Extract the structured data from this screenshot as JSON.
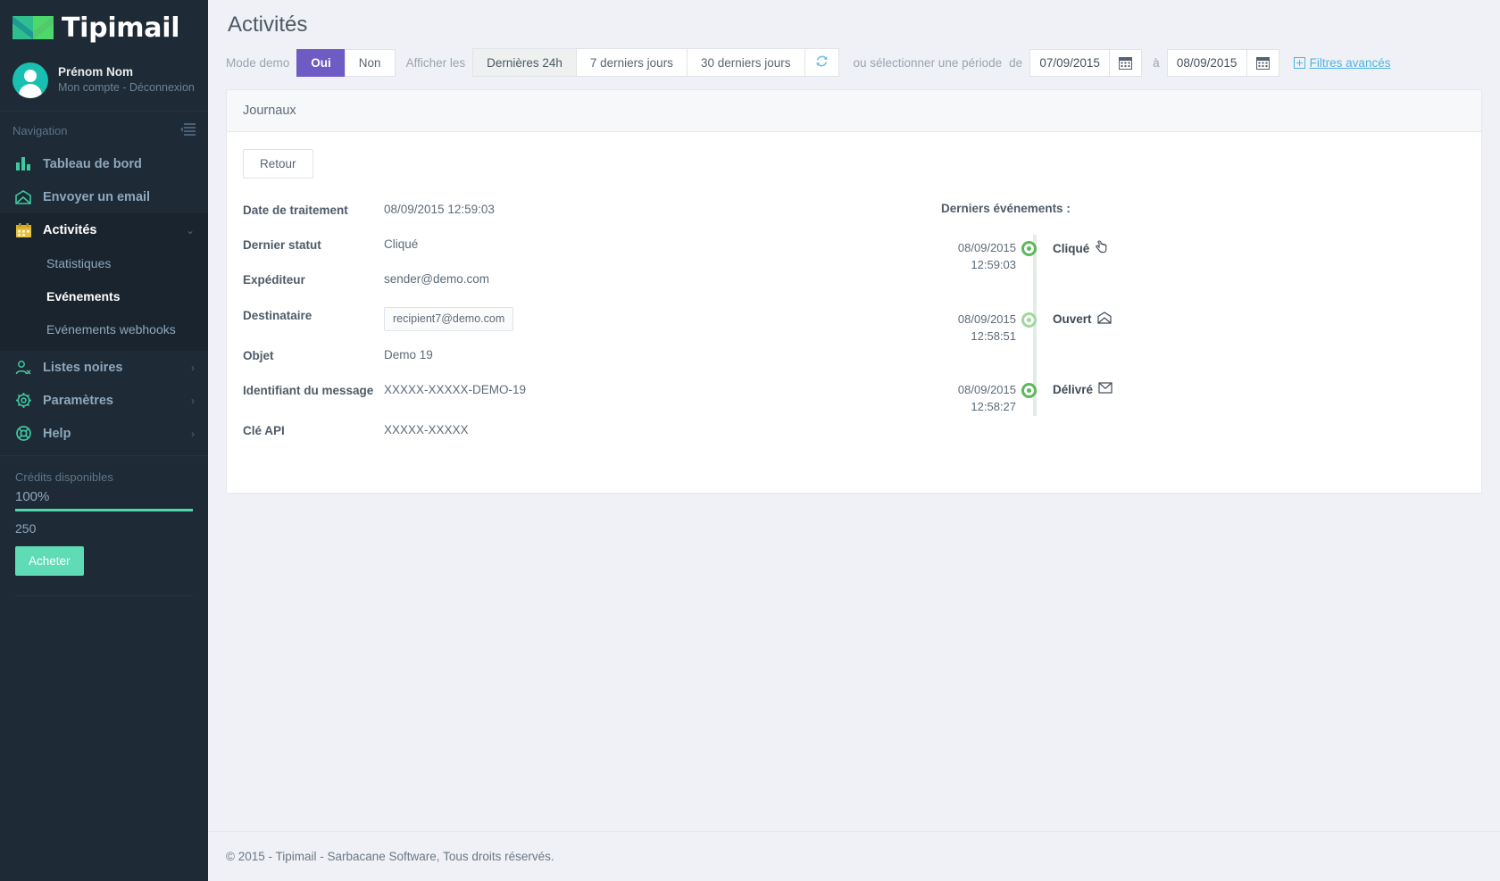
{
  "brand": {
    "name": "Tipimail"
  },
  "user": {
    "name": "Prénom Nom",
    "links": "Mon compte - Déconnexion"
  },
  "sidebar": {
    "nav_title": "Navigation",
    "collapse_icon": "collapse-menu-icon",
    "items": [
      {
        "label": "Tableau de bord",
        "icon": "bar-chart-icon",
        "chevron": ""
      },
      {
        "label": "Envoyer un email",
        "icon": "envelope-open-icon",
        "chevron": ""
      },
      {
        "label": "Activités",
        "icon": "calendar-icon",
        "chevron": "⌄",
        "active": true
      },
      {
        "label": "Listes noires",
        "icon": "user-block-icon",
        "chevron": "›"
      },
      {
        "label": "Paramètres",
        "icon": "gear-icon",
        "chevron": "›"
      },
      {
        "label": "Help",
        "icon": "lifebuoy-icon",
        "chevron": "›"
      }
    ],
    "subitems": [
      {
        "label": "Statistiques",
        "active": false
      },
      {
        "label": "Evénements",
        "active": true
      },
      {
        "label": "Evénements webhooks",
        "active": false
      }
    ],
    "credits": {
      "label": "Crédits disponibles",
      "percent": "100%",
      "count": "250",
      "buy_label": "Acheter",
      "bar_color": "#4fd8ab"
    }
  },
  "header": {
    "title": "Activités"
  },
  "toolbar": {
    "demo_mode_label": "Mode demo",
    "demo_yes": "Oui",
    "demo_no": "Non",
    "show_label": "Afficher les",
    "ranges": [
      "Dernières 24h",
      "7 derniers jours",
      "30 derniers jours"
    ],
    "active_range": "Dernières 24h",
    "refresh_icon": "refresh-icon",
    "or_period_label": "ou sélectionner une période",
    "from_label": "de",
    "to_label": "à",
    "date_from": "07/09/2015",
    "date_to": "08/09/2015",
    "calendar_icon": "calendar-icon",
    "advanced_filters": "Filtres avancés",
    "accent_purple": "#6e5cc4",
    "link_blue": "#52b3e4"
  },
  "panel": {
    "title": "Journaux",
    "back_label": "Retour",
    "details": [
      {
        "label": "Date de traitement",
        "value": "08/09/2015 12:59:03",
        "chip": false
      },
      {
        "label": "Dernier statut",
        "value": "Cliqué",
        "chip": false
      },
      {
        "label": "Expéditeur",
        "value": "sender@demo.com",
        "chip": false
      },
      {
        "label": "Destinataire",
        "value": "recipient7@demo.com",
        "chip": true
      },
      {
        "label": "Objet",
        "value": "Demo 19",
        "chip": false
      },
      {
        "label": "Identifiant du message",
        "value": "XXXXX-XXXXX-DEMO-19",
        "chip": false
      },
      {
        "label": "Clé API",
        "value": "XXXXX-XXXXX",
        "chip": false
      }
    ],
    "timeline": {
      "title": "Derniers événements :",
      "events": [
        {
          "date": "08/09/2015",
          "time": "12:59:03",
          "label": "Cliqué",
          "icon": "click-cursor-icon",
          "glyph": "☞",
          "dot": "dark"
        },
        {
          "date": "08/09/2015",
          "time": "12:58:51",
          "label": "Ouvert",
          "icon": "envelope-open-icon",
          "glyph": "✉",
          "dot": "light"
        },
        {
          "date": "08/09/2015",
          "time": "12:58:27",
          "label": "Délivré",
          "icon": "envelope-icon",
          "glyph": "✉",
          "dot": "dark"
        }
      ]
    }
  },
  "footer": {
    "text": "© 2015 - Tipimail - Sarbacane Software, Tous droits réservés."
  }
}
